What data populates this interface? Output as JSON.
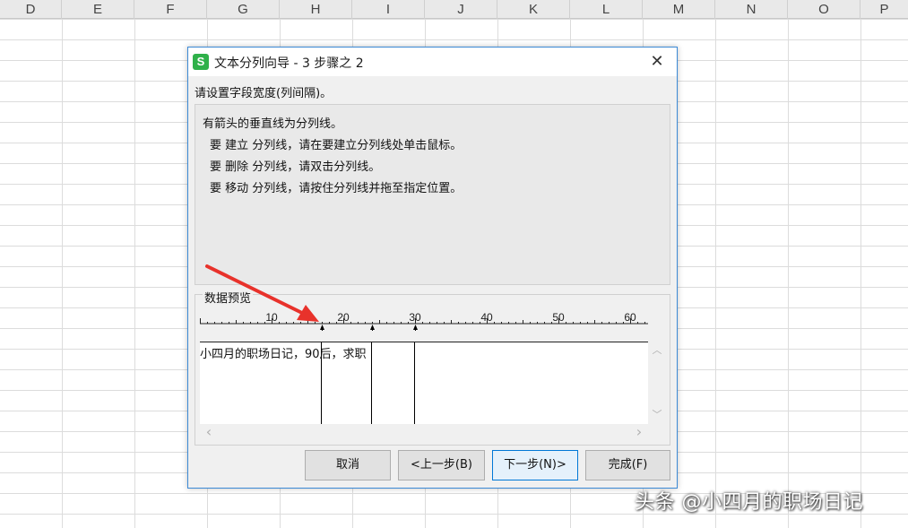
{
  "sheet": {
    "columns": [
      "D",
      "E",
      "F",
      "G",
      "H",
      "I",
      "J",
      "K",
      "L",
      "M",
      "N",
      "O",
      "P"
    ]
  },
  "dialog": {
    "icon_glyph": "S",
    "title": "文本分列向导 - 3 步骤之 2",
    "close_glyph": "✕",
    "instruction": "请设置字段宽度(列间隔)。",
    "info_lines": [
      "有箭头的垂直线为分列线。",
      "要 建立 分列线，请在要建立分列线处单击鼠标。",
      "要 删除 分列线，请双击分列线。",
      "要 移动 分列线，请按住分列线并拖至指定位置。"
    ],
    "preview_label": "数据预览",
    "ruler_labels": [
      "10",
      "20",
      "30",
      "40",
      "50",
      "60"
    ],
    "preview_text": "小四月的职场日记，90后，求职",
    "column_break_positions": [
      17,
      24,
      30
    ],
    "buttons": {
      "cancel": "取消",
      "back": "<上一步(B)",
      "next": "下一步(N)>",
      "finish": "完成(F)"
    },
    "scroll_up": "︿",
    "scroll_down": "﹀",
    "scroll_left": "‹",
    "scroll_right": "›"
  },
  "watermark": "头条 @小四月的职场日记",
  "colors": {
    "dialog_border": "#3c8ad6",
    "app_icon": "#2fb14a",
    "annotation_arrow": "#e8322b",
    "primary_button_border": "#0078d7"
  }
}
